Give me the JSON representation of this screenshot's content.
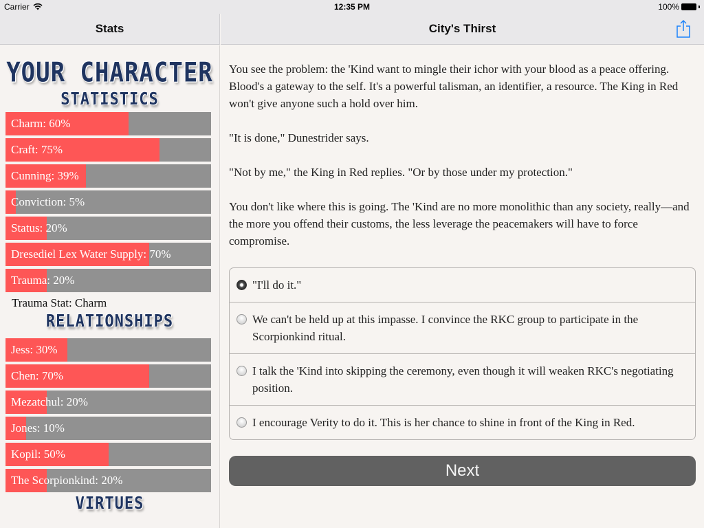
{
  "status_bar": {
    "carrier": "Carrier",
    "time": "12:35 PM",
    "battery": "100%"
  },
  "left_nav": {
    "title": "Stats"
  },
  "right_nav": {
    "title": "City's Thirst",
    "share_icon": "share-icon"
  },
  "sidebar": {
    "title": "YOUR CHARACTER",
    "statistics_heading": "STATISTICS",
    "statistics": [
      {
        "label": "Charm: 60%",
        "value": 60
      },
      {
        "label": "Craft: 75%",
        "value": 75
      },
      {
        "label": "Cunning: 39%",
        "value": 39
      },
      {
        "label": "Conviction: 5%",
        "value": 5
      },
      {
        "label": "Status: 20%",
        "value": 20
      },
      {
        "label": "Dresediel Lex Water Supply: 70%",
        "value": 70
      },
      {
        "label": "Trauma: 20%",
        "value": 20
      }
    ],
    "trauma_stat": "Trauma Stat: Charm",
    "relationships_heading": "RELATIONSHIPS",
    "relationships": [
      {
        "label": "Jess: 30%",
        "value": 30
      },
      {
        "label": "Chen: 70%",
        "value": 70
      },
      {
        "label": "Mezatchul: 20%",
        "value": 20
      },
      {
        "label": "Jones: 10%",
        "value": 10
      },
      {
        "label": "Kopil: 50%",
        "value": 50
      },
      {
        "label": "The Scorpionkind: 20%",
        "value": 20
      }
    ],
    "virtues_heading": "VIRTUES"
  },
  "story": {
    "paragraphs": [
      "You see the problem: the 'Kind want to mingle their ichor with your blood as a peace offering. Blood's a gateway to the self. It's a powerful talisman, an identifier, a resource. The King in Red won't give anyone such a hold over him.",
      "\"It is done,\" Dunestrider says.",
      "\"Not by me,\" the King in Red replies. \"Or by those under my protection.\"",
      "You don't like where this is going. The 'Kind are no more monolithic than any society, really—and the more you offend their customs, the less leverage the peacemakers will have to force compromise."
    ],
    "choices": [
      {
        "label": "\"I'll do it.\"",
        "selected": true
      },
      {
        "label": "We can't be held up at this impasse. I convince the RKC group to participate in the Scorpionkind ritual.",
        "selected": false
      },
      {
        "label": "I talk the 'Kind into skipping the ceremony, even though it will weaken RKC's negotiating position.",
        "selected": false
      },
      {
        "label": "I encourage Verity to do it. This is her chance to shine in front of the King in Red.",
        "selected": false
      }
    ],
    "next_label": "Next"
  },
  "colors": {
    "bar_fill": "#fe5656",
    "bar_track": "#919191",
    "heading": "#1f3460",
    "accent": "#1a82fb",
    "next_button": "#616161"
  }
}
